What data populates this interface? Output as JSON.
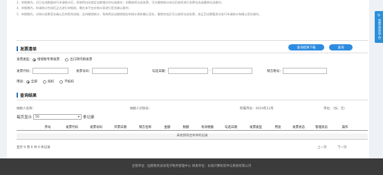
{
  "notes": [
    "2、申报期内，对已勾选数据进行申请统计后，系统将自动锁定当期相应的勾选操作；如需继续勾选发票，可在撤销统计成功后继续进行发票勾选或撤销勾选操作；",
    "4、申报期内，申请统计完成后正式进行申报前，需在本平台对统计表进行签名确认操作；",
    "5、申报期内，对统计结果签名确认后申报完成前，支持撤销统计，系统将自动撤销相应的统计表和确认签名，撤销完成后可以继续勾选发票，修正后也需要再次进行申请统计和确认签名操作。"
  ],
  "side_tab": {
    "label": "发票查验平台",
    "icon": "globe-icon"
  },
  "invoice_section": {
    "title": "发票清单",
    "download_button": "查询结果下载",
    "query_button": "查询"
  },
  "filters": {
    "invoice_type_label": "发票类型：",
    "invoice_type_options": [
      {
        "label": "增值税专用发票",
        "checked": true
      },
      {
        "label": "出口转内销发票",
        "checked": false
      }
    ],
    "invoice_code_label": "发票代码：",
    "invoice_number_label": "发票号码：",
    "check_date_label": "勾选日期：",
    "date_separator": "-",
    "seller_tax_id_label": "销方税号：",
    "purpose_label": "用途：",
    "purpose_options": [
      {
        "label": "全部",
        "checked": true
      },
      {
        "label": "抵扣",
        "checked": false
      },
      {
        "label": "不抵扣",
        "checked": false
      }
    ]
  },
  "results": {
    "title": "查询结果",
    "taxpayer_name_label": "纳税人名称：",
    "taxpayer_id_label": "纳税人识别号：",
    "period_label": "所属月份：2019年11月",
    "unit_label": "单位：（份、元）",
    "page_size_prefix": "每页显示",
    "page_size_value": "50",
    "page_size_suffix": "条记录",
    "columns": [
      "序号",
      "发票代码",
      "发票号码",
      "开票日期",
      "销方名称",
      "金额",
      "税额",
      "有效税额",
      "勾选日期",
      "发票类型",
      "用途",
      "发票状态",
      "管理状态",
      "操作"
    ],
    "empty_message": "未找到符合条件的记录",
    "info": "显示 0 到 0 共 0 条记录",
    "prev": "上一页",
    "next": "下一页"
  },
  "footer": "主管单位：国家税务总局电子税务管理中心    研发单位：长城计算机软件与系统有限公司",
  "colors": {
    "accent": "#2d8be0",
    "footer_bg": "#3b3b3b"
  }
}
